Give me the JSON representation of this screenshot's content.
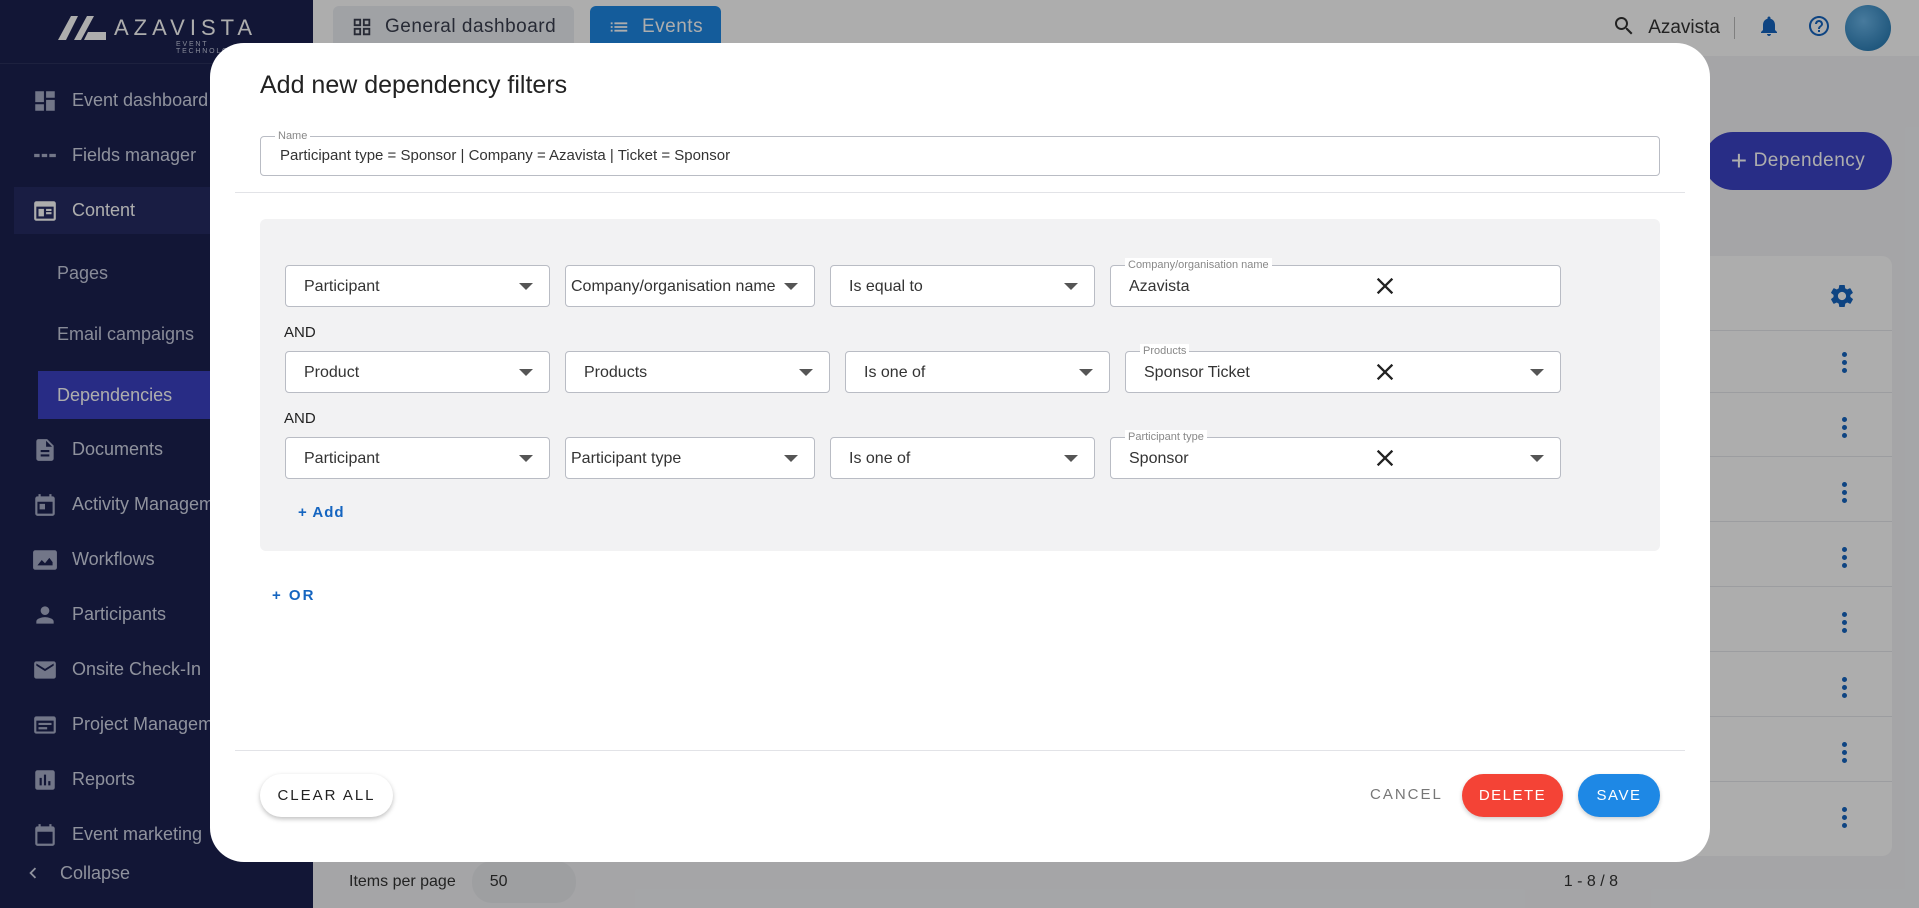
{
  "app": {
    "brand": "AZAVISTA",
    "tagline": "EVENT TECHNOLOGY"
  },
  "header": {
    "tabs": [
      {
        "label": "General dashboard",
        "icon": "dashboard-icon"
      },
      {
        "label": "Events",
        "icon": "list-icon"
      }
    ],
    "client": "Azavista",
    "add_dependency_label": "Dependency"
  },
  "sidebar": {
    "items": [
      {
        "label": "Event dashboard",
        "icon": "dashboard-icon"
      },
      {
        "label": "Fields manager",
        "icon": "fields-icon"
      },
      {
        "label": "Content",
        "icon": "content-icon"
      },
      {
        "label": "Pages"
      },
      {
        "label": "Email campaigns"
      },
      {
        "label": "Dependencies"
      },
      {
        "label": "Documents",
        "icon": "document-icon"
      },
      {
        "label": "Activity Managem",
        "icon": "calendar-icon"
      },
      {
        "label": "Workflows",
        "icon": "workflow-icon"
      },
      {
        "label": "Participants",
        "icon": "person-icon"
      },
      {
        "label": "Onsite Check-In",
        "icon": "mail-icon"
      },
      {
        "label": "Project Managem",
        "icon": "project-icon"
      },
      {
        "label": "Reports",
        "icon": "reports-icon"
      },
      {
        "label": "Event marketing",
        "icon": "calendar-icon"
      }
    ],
    "collapse_label": "Collapse"
  },
  "table": {
    "pager": {
      "items_per_page_label": "Items per page",
      "items_per_page": "50",
      "range": "1 - 8 / 8"
    }
  },
  "modal": {
    "title": "Add new dependency filters",
    "name_field": {
      "label": "Name",
      "value": "Participant type = Sponsor  |  Company = Azavista  |  Ticket = Sponsor"
    },
    "conjunction": "AND",
    "rows": [
      {
        "entity": "Participant",
        "field": "Company/organisation name",
        "operator": "Is equal to",
        "value_label": "Company/organisation name",
        "value": "Azavista"
      },
      {
        "entity": "Product",
        "field": "Products",
        "operator": "Is one of",
        "value_label": "Products",
        "value": "Sponsor Ticket"
      },
      {
        "entity": "Participant",
        "field": "Participant type",
        "operator": "Is one of",
        "value_label": "Participant type",
        "value": "Sponsor"
      }
    ],
    "add_label": "+  Add",
    "or_label": "+    OR",
    "buttons": {
      "clear_all": "CLEAR ALL",
      "cancel": "CANCEL",
      "delete": "DELETE",
      "save": "SAVE"
    }
  }
}
